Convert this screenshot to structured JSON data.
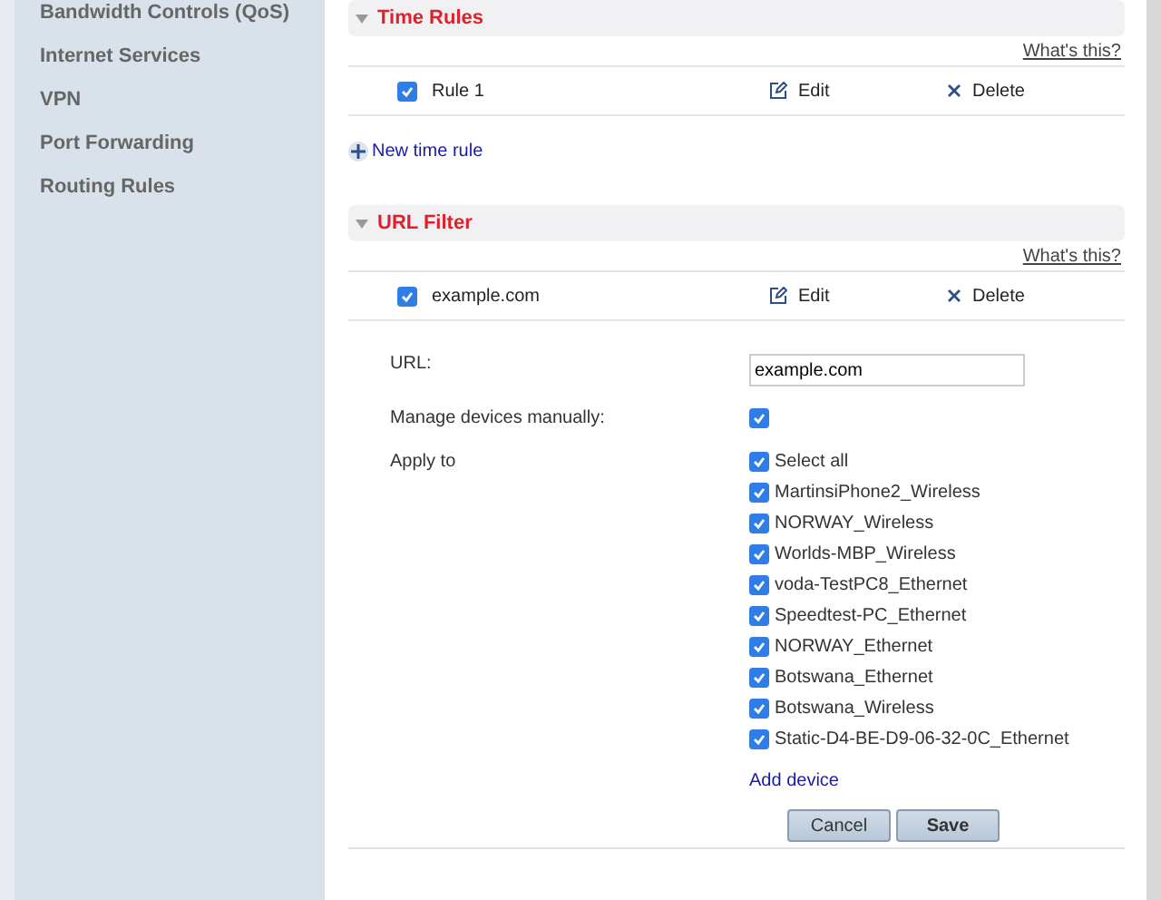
{
  "sidebar": {
    "items": [
      {
        "label": "Bandwidth Controls (QoS)"
      },
      {
        "label": "Internet Services"
      },
      {
        "label": "VPN"
      },
      {
        "label": "Port Forwarding"
      },
      {
        "label": "Routing Rules"
      }
    ]
  },
  "time_rules": {
    "title": "Time Rules",
    "expanded": true,
    "help": "What's this?",
    "rules": [
      {
        "name": "Rule 1",
        "checked": true,
        "edit": "Edit",
        "delete": "Delete"
      }
    ],
    "add_link": "New time rule"
  },
  "url_filter": {
    "title": "URL Filter",
    "expanded": true,
    "help": "What's this?",
    "rules": [
      {
        "name": "example.com",
        "checked": true,
        "edit": "Edit",
        "delete": "Delete"
      }
    ],
    "form": {
      "url_label": "URL:",
      "url_value": "example.com",
      "manage_label": "Manage devices manually:",
      "manage_checked": true,
      "apply_label": "Apply to",
      "devices": [
        {
          "name": "Select all",
          "checked": true
        },
        {
          "name": "MartinsiPhone2_Wireless",
          "checked": true
        },
        {
          "name": "NORWAY_Wireless",
          "checked": true
        },
        {
          "name": "Worlds-MBP_Wireless",
          "checked": true
        },
        {
          "name": "voda-TestPC8_Ethernet",
          "checked": true
        },
        {
          "name": "Speedtest-PC_Ethernet",
          "checked": true
        },
        {
          "name": "NORWAY_Ethernet",
          "checked": true
        },
        {
          "name": "Botswana_Ethernet",
          "checked": true
        },
        {
          "name": "Botswana_Wireless",
          "checked": true
        },
        {
          "name": "Static-D4-BE-D9-06-32-0C_Ethernet",
          "checked": true
        }
      ],
      "add_device": "Add device",
      "buttons": [
        {
          "label": "Cancel",
          "kind": "secondary"
        },
        {
          "label": "Save",
          "kind": "primary"
        }
      ]
    }
  }
}
